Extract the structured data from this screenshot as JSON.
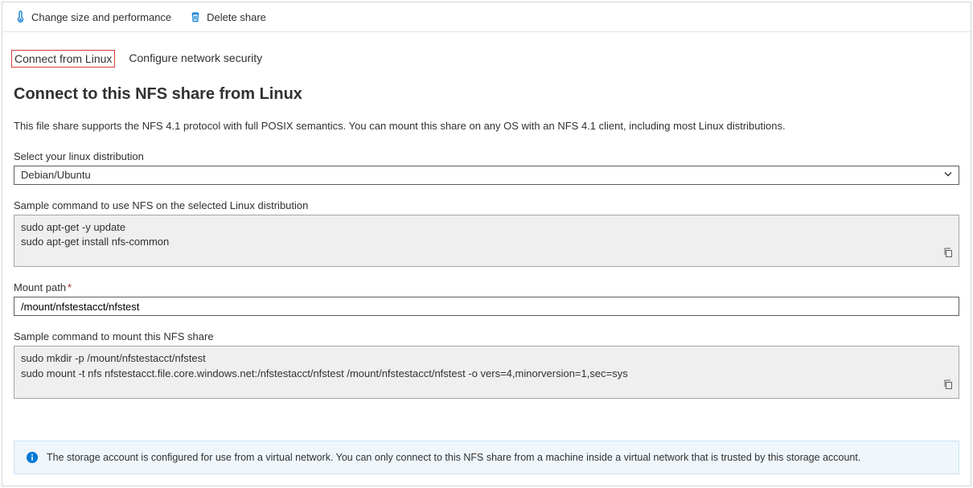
{
  "toolbar": {
    "resize_label": "Change size and performance",
    "delete_label": "Delete share"
  },
  "tabs": {
    "connect": "Connect from Linux",
    "network": "Configure network security"
  },
  "page": {
    "title": "Connect to this NFS share from Linux",
    "description": "This file share supports the NFS 4.1 protocol with full POSIX semantics. You can mount this share on any OS with an NFS 4.1 client, including most Linux distributions."
  },
  "distro": {
    "label": "Select your linux distribution",
    "value": "Debian/Ubuntu"
  },
  "install_cmd": {
    "label": "Sample command to use NFS on the selected Linux distribution",
    "value": "sudo apt-get -y update\nsudo apt-get install nfs-common"
  },
  "mount_path": {
    "label": "Mount path",
    "value": "/mount/nfstestacct/nfstest"
  },
  "mount_cmd": {
    "label": "Sample command to mount this NFS share",
    "value": "sudo mkdir -p /mount/nfstestacct/nfstest\nsudo mount -t nfs nfstestacct.file.core.windows.net:/nfstestacct/nfstest /mount/nfstestacct/nfstest -o vers=4,minorversion=1,sec=sys"
  },
  "info": {
    "message": "The storage account is configured for use from a virtual network. You can only connect to this NFS share from a machine inside a virtual network that is trusted by this storage account."
  }
}
